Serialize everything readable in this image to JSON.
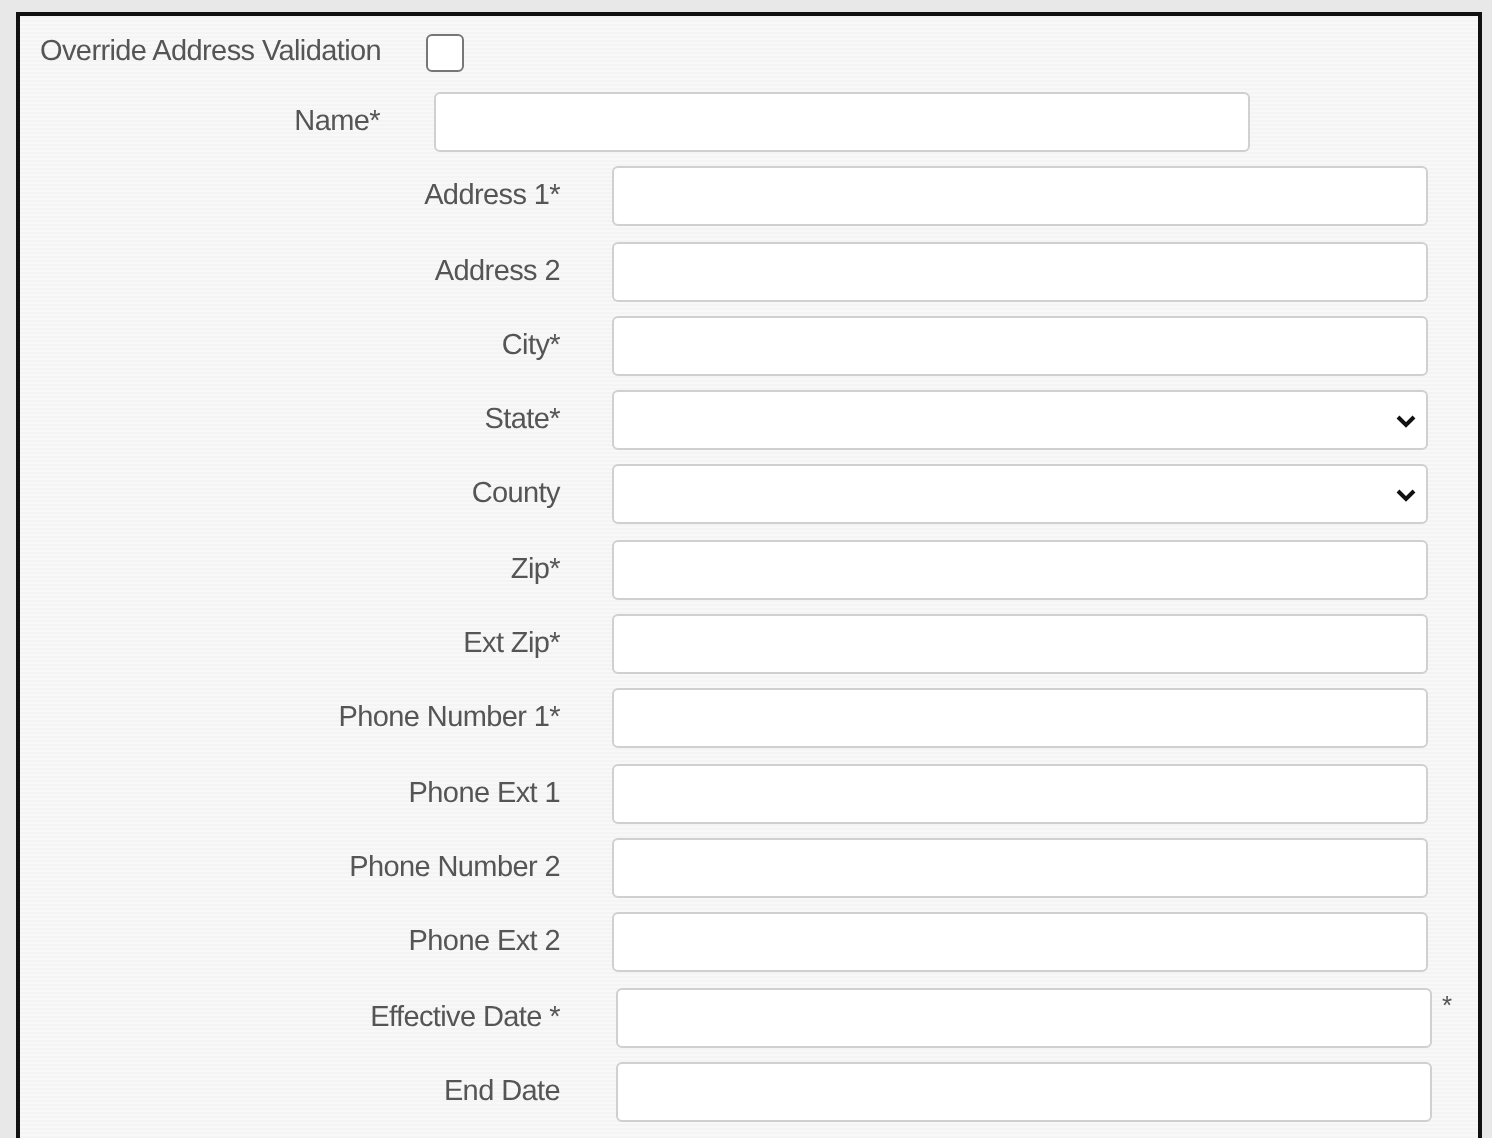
{
  "override": {
    "label": "Override Address Validation",
    "checked": false
  },
  "name_field": {
    "label": "Name*"
  },
  "fields": [
    {
      "label": "Address 1*",
      "kind": "text"
    },
    {
      "label": "Address 2",
      "kind": "text"
    },
    {
      "label": "City*",
      "kind": "text"
    },
    {
      "label": "State*",
      "kind": "select"
    },
    {
      "label": "County",
      "kind": "select"
    },
    {
      "label": "Zip*",
      "kind": "text"
    },
    {
      "label": "Ext Zip*",
      "kind": "text"
    },
    {
      "label": "Phone Number 1*",
      "kind": "text"
    },
    {
      "label": "Phone Ext 1",
      "kind": "text"
    },
    {
      "label": "Phone Number 2",
      "kind": "text"
    },
    {
      "label": "Phone Ext 2",
      "kind": "text"
    },
    {
      "label": "Effective Date *",
      "kind": "date",
      "note": "*"
    },
    {
      "label": "End Date",
      "kind": "date"
    }
  ]
}
